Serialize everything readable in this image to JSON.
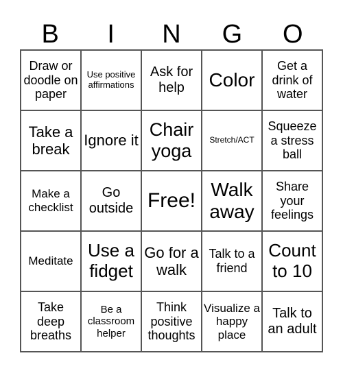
{
  "header": [
    "B",
    "I",
    "N",
    "G",
    "O"
  ],
  "cells": [
    "Draw or doodle on paper",
    "Use positive affirmations",
    "Ask for help",
    "Color",
    "Get a drink of water",
    "Take a break",
    "Ignore it",
    "Chair yoga",
    "Stretch/ACT",
    "Squeeze a stress ball",
    "Make a checklist",
    "Go outside",
    "Free!",
    "Walk away",
    "Share your feelings",
    "Meditate",
    "Use a fidget",
    "Go for a walk",
    "Talk to a friend",
    "Count to 10",
    "Take deep breaths",
    "Be a classroom helper",
    "Think positive thoughts",
    "Visualize a happy place",
    "Talk to an adult"
  ]
}
